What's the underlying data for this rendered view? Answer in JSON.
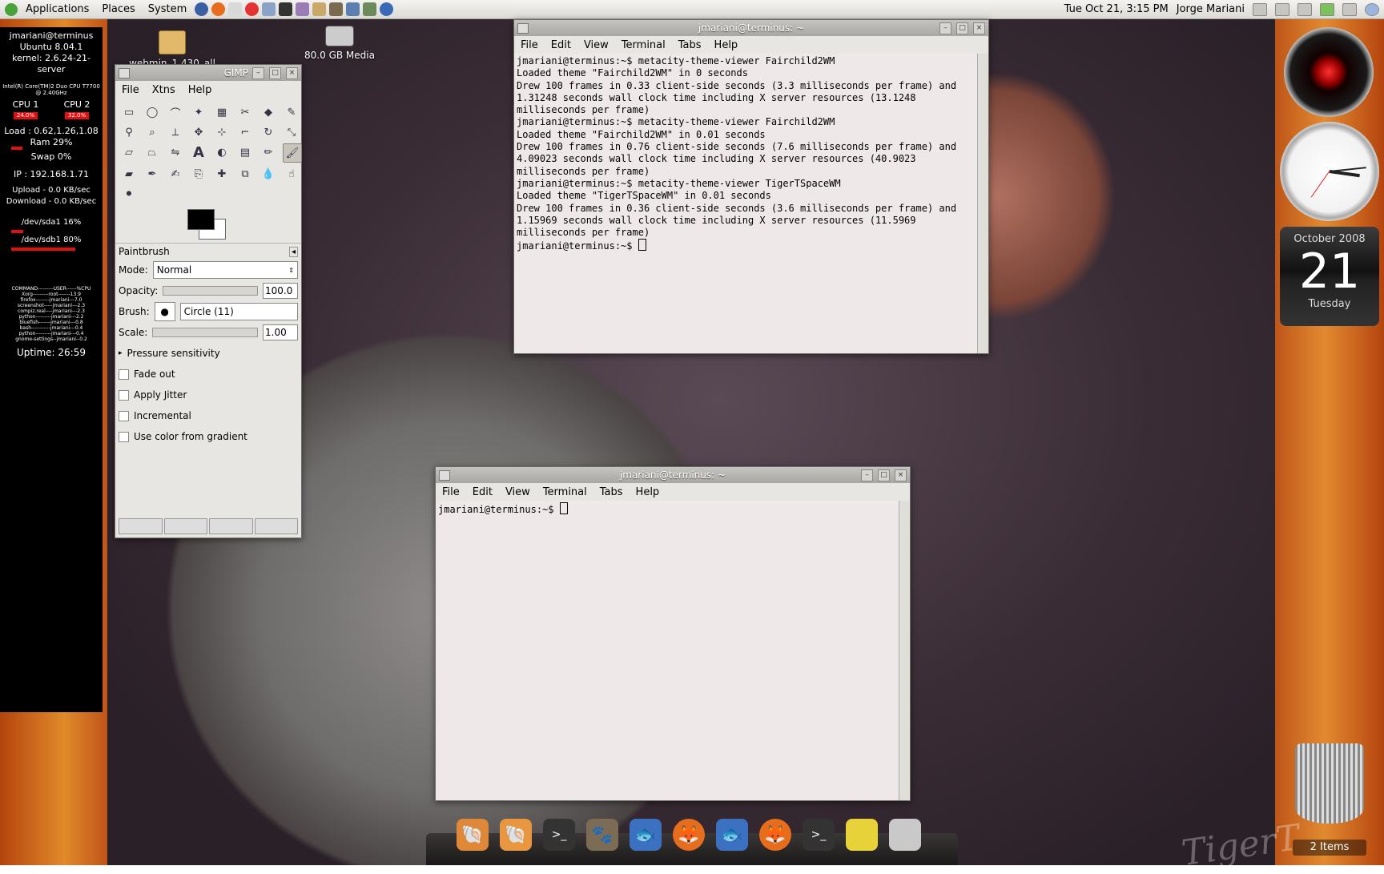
{
  "top_panel": {
    "menus": [
      "Applications",
      "Places",
      "System"
    ],
    "datetime": "Tue Oct 21,  3:15 PM",
    "user": "Jorge Mariani"
  },
  "conky": {
    "host": "jmariani@terminus",
    "os": "Ubuntu 8.04.1",
    "kernel": "kernel: 2.6.24-21-server",
    "cpu_info": "Intel(R) Core(TM)2 Duo CPU     T7700  @ 2.40GHz",
    "cpu1_label": "CPU 1",
    "cpu2_label": "CPU 2",
    "cpu1_value": "24.0%",
    "cpu2_value": "32.0%",
    "load": "Load : 0.62,1.26,1.08",
    "ram": "Ram 29%",
    "ram_fraction": 0.29,
    "swap": "Swap 0%",
    "ip": "IP : 192.168.1.71",
    "upload": "Upload - 0.0 KB/sec",
    "download": "Download - 0.0 KB/sec",
    "disk1": "/dev/sda1 16%",
    "disk1_fraction": 0.16,
    "disk2": "/dev/sdb1 80%",
    "disk2_fraction": 0.8,
    "processes": [
      "COMMAND---------USER------%CPU",
      "Xorg---------root-------13.9",
      "firefox--------jmariani---7.0",
      "screenshot-----jmariani---2.3",
      "compiz.real----jmariani---2.3",
      "python---------jmariani---2.2",
      "bluefish-------jmariani---0.8",
      "bash-----------jmariani---0.4",
      "python---------jmariani---0.4",
      "gnome-settings--jmariani--0.2"
    ],
    "uptime": "Uptime: 26:59"
  },
  "desktop_icons": {
    "webmin": "webmin_1.430_all",
    "media": "80.0 GB Media"
  },
  "gimp": {
    "title": "GIMP",
    "menu": [
      "File",
      "Xtns",
      "Help"
    ],
    "tool_options_title": "Paintbrush",
    "mode_label": "Mode:",
    "mode_value": "Normal",
    "opacity_label": "Opacity:",
    "opacity_value": "100.0",
    "brush_label": "Brush:",
    "brush_value": "Circle (11)",
    "scale_label": "Scale:",
    "scale_value": "1.00",
    "pressure": "Pressure sensitivity",
    "checks": [
      "Fade out",
      "Apply Jitter",
      "Incremental",
      "Use color from gradient"
    ]
  },
  "terminal1": {
    "title": "jmariani@terminus: ~",
    "menu": [
      "File",
      "Edit",
      "View",
      "Terminal",
      "Tabs",
      "Help"
    ],
    "content": "jmariani@terminus:~$ metacity-theme-viewer Fairchild2WM\nLoaded theme \"Fairchild2WM\" in 0 seconds\nDrew 100 frames in 0.33 client-side seconds (3.3 milliseconds per frame) and 1.31248 seconds wall clock time including X server resources (13.1248 milliseconds per frame)\njmariani@terminus:~$ metacity-theme-viewer Fairchild2WM\nLoaded theme \"Fairchild2WM\" in 0.01 seconds\nDrew 100 frames in 0.76 client-side seconds (7.6 milliseconds per frame) and 4.09023 seconds wall clock time including X server resources (40.9023 milliseconds per frame)\njmariani@terminus:~$ metacity-theme-viewer TigerTSpaceWM\nLoaded theme \"TigerTSpaceWM\" in 0.01 seconds\nDrew 100 frames in 0.36 client-side seconds (3.6 milliseconds per frame) and 1.15969 seconds wall clock time including X server resources (11.5969 milliseconds per frame)\n",
    "prompt": "jmariani@terminus:~$ "
  },
  "terminal2": {
    "title": "jmariani@terminus: ~",
    "menu": [
      "File",
      "Edit",
      "View",
      "Terminal",
      "Tabs",
      "Help"
    ],
    "prompt": "jmariani@terminus:~$ "
  },
  "calendar": {
    "month": "October 2008",
    "day": "21",
    "weekday": "Tuesday"
  },
  "trash": {
    "label": "2 Items"
  },
  "wallpaper_text": "TigerT",
  "colors": {
    "conky_bar": "#e01010",
    "panel": "#e8e6e2"
  }
}
